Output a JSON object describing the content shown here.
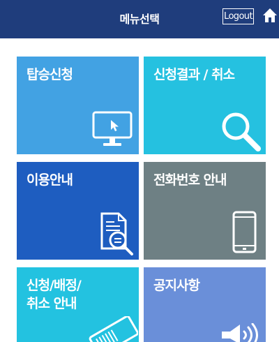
{
  "header": {
    "title": "메뉴선택",
    "logout_label": "Logout"
  },
  "tiles": [
    {
      "label": "탑승신청",
      "icon": "monitor-icon",
      "color": "#42a2e3"
    },
    {
      "label": "신청결과 / 취소",
      "icon": "magnifier-icon",
      "color": "#25c1e0"
    },
    {
      "label": "이용안내",
      "icon": "document-search-icon",
      "color": "#1e5dc0"
    },
    {
      "label": "전화번호 안내",
      "icon": "smartphone-icon",
      "color": "#6e8084"
    },
    {
      "label": "신청/배정/\n취소 안내",
      "icon": "ticket-icon",
      "color": "#23c2e0"
    },
    {
      "label": "공지사항",
      "icon": "megaphone-icon",
      "color": "#6a8fd9"
    }
  ],
  "colors": {
    "header_bg": "#1f3d7c",
    "page_bg": "#ffffff"
  }
}
